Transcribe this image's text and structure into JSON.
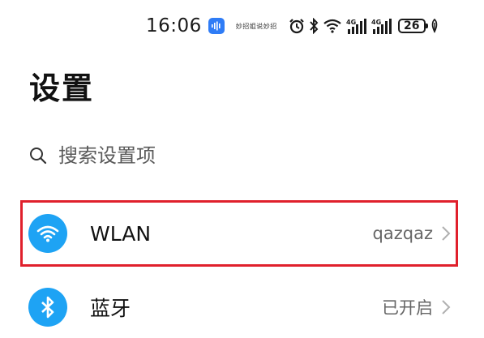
{
  "status_bar": {
    "time": "16:06",
    "brand_text": "妙招姐说妙招",
    "battery_level": "26",
    "icons": [
      "voice-assistant-icon",
      "alarm-icon",
      "bluetooth-icon",
      "wifi-icon",
      "4g-signal-icon",
      "4g-signal-icon",
      "battery-icon",
      "leaf-icon"
    ],
    "network_label_1": "4G",
    "network_label_2": "4G"
  },
  "page": {
    "title": "设置"
  },
  "search": {
    "placeholder": "搜索设置项"
  },
  "settings_items": [
    {
      "label": "WLAN",
      "value": "qazqaz",
      "icon": "wifi-icon",
      "highlighted": true
    },
    {
      "label": "蓝牙",
      "value": "已开启",
      "icon": "bluetooth-icon",
      "highlighted": false
    }
  ],
  "colors": {
    "icon_bg": "#1ea3f4",
    "highlight": "#e0202c",
    "voice_bg": "#2f7cf6"
  }
}
